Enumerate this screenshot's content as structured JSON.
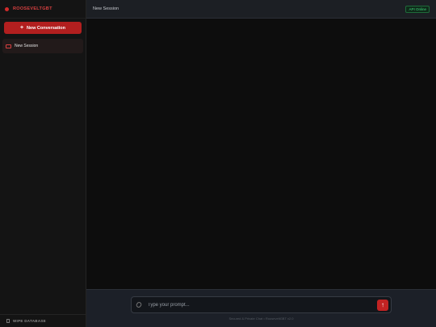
{
  "sidebar": {
    "brand": "ROOSEVELTGBT",
    "new_conversation_label": "New Conversation",
    "new_conversation_icon": "+",
    "sessions": [
      {
        "label": "New Session",
        "icon": "chat-icon"
      }
    ],
    "wipe_label": "WIPE DATABASE"
  },
  "header": {
    "title": "New Session",
    "api_status": "API Online"
  },
  "composer": {
    "placeholder": "Type your prompt...",
    "send_icon": "↑",
    "footer": "Secured & Private Chat • RooseveltGBT v2.0"
  },
  "colors": {
    "accent": "#c22323",
    "status_online": "#3fd27a",
    "sidebar_bg": "#141414",
    "main_bg": "#0d0d0d"
  }
}
